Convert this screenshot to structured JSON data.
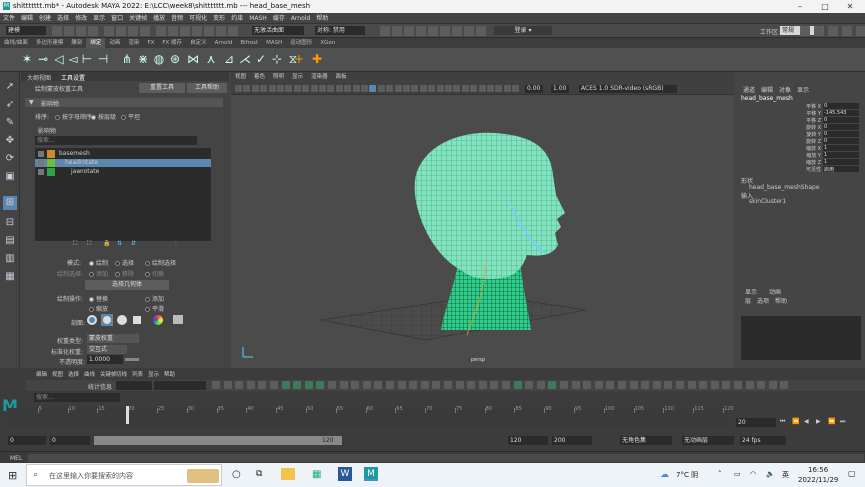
{
  "window": {
    "title": "shittttttt.mb* - Autodesk MAYA 2022: E:\\LCC\\week8\\shittttttt.mb  ---  head_base_mesh"
  },
  "menubar": [
    "文件",
    "编辑",
    "创建",
    "选择",
    "修改",
    "显示",
    "窗口",
    "关键帧",
    "播放",
    "音频",
    "可视化",
    "变形",
    "约束",
    "MASH",
    "缓存",
    "Arnold",
    "帮助"
  ],
  "workspace": {
    "label": "工作区:",
    "value": "常规"
  },
  "statusline": {
    "mode": "建模",
    "snap_label": "无激活曲面",
    "symmetry": "对称: 禁用",
    "login": "登录"
  },
  "shelf_tabs": [
    "曲线/曲面",
    "多边形建模",
    "雕刻",
    "绑定",
    "动画",
    "渲染",
    "FX",
    "FX 缓存",
    "自定义",
    "Arnold",
    "Bifrost",
    "MASH",
    "运动图形",
    "XGen"
  ],
  "shelf_active": "绑定",
  "tool_tabs": [
    "大纲视图",
    "工具设置"
  ],
  "tool_title": "绘制蒙皮权重工具",
  "tool_buttons": {
    "reset": "重置工具",
    "help": "工具帮助"
  },
  "influence_header": "影响物",
  "sort": {
    "label": "排序:",
    "options": [
      "按字母顺序",
      "按层级",
      "平坦"
    ]
  },
  "search_placeholder": "搜索...",
  "joints": [
    {
      "name": "basemesh",
      "color": "#d08a2a"
    },
    {
      "name": "headrotate",
      "color": "#6bbf3a"
    },
    {
      "name": "jawrotate",
      "color": "#2fa34a"
    }
  ],
  "mode": {
    "label": "模式:",
    "options": [
      "绘制",
      "选择",
      "绘制选择"
    ]
  },
  "paint_select": {
    "label": "绘制选择:",
    "options": [
      "添加",
      "移除",
      "切换"
    ]
  },
  "select_geo": "选择几何体",
  "paint_op": {
    "label": "绘制操作:",
    "options": [
      "替换",
      "添加",
      "缩放",
      "平滑"
    ]
  },
  "profile_label": "剖面:",
  "weight_type": {
    "label": "权重类型:",
    "value": "蒙皮权重"
  },
  "normalize": {
    "label": "标准化权重:",
    "value": "交互式"
  },
  "opacity": {
    "label": "不透明度:",
    "value": "1.0000"
  },
  "viewport_menu": [
    "视图",
    "着色",
    "照明",
    "显示",
    "渲染器",
    "面板"
  ],
  "viewport_fields": {
    "v1": "0.00",
    "v2": "1.00",
    "colorspace": "ACES 1.0 SDR-video (sRGB)"
  },
  "viewport_label": "persp",
  "channel_tabs": [
    "通道",
    "编辑",
    "对象",
    "显示"
  ],
  "object_name": "head_base_mesh",
  "attributes": [
    {
      "name": "平移 X",
      "value": "0"
    },
    {
      "name": "平移 Y",
      "value": "-145.543"
    },
    {
      "name": "平移 Z",
      "value": "0"
    },
    {
      "name": "旋转 X",
      "value": "0"
    },
    {
      "name": "旋转 Y",
      "value": "0"
    },
    {
      "name": "旋转 Z",
      "value": "0"
    },
    {
      "name": "缩放 X",
      "value": "1"
    },
    {
      "name": "缩放 Y",
      "value": "1"
    },
    {
      "name": "缩放 Z",
      "value": "1"
    },
    {
      "name": "可见性",
      "value": "启用"
    }
  ],
  "shapes_label": "形状",
  "shape_name": "head_base_meshShape",
  "inputs_label": "输入",
  "input_name": "skinCluster1",
  "layer_tabs": [
    "显示",
    "动画"
  ],
  "layer_menu": [
    "层",
    "选项",
    "帮助"
  ],
  "timeline": {
    "ticks": [
      "5",
      "10",
      "15",
      "20",
      "25",
      "30",
      "35",
      "40",
      "45",
      "50",
      "55",
      "60",
      "65",
      "70",
      "75",
      "80",
      "85",
      "90",
      "95",
      "100",
      "105",
      "110",
      "115",
      "120"
    ],
    "current": "20",
    "start": "0",
    "start2": "0",
    "range_end": "120",
    "end": "120",
    "end2": "200"
  },
  "graph_menu": [
    "编辑",
    "视图",
    "选择",
    "曲线",
    "关键帧",
    "切线",
    "列表",
    "显示",
    "帮助"
  ],
  "graph_search": "搜索...",
  "stats_label": "统计信息",
  "playback": {
    "char": "无角色集",
    "layer": "无动画层",
    "fps": "24 fps"
  },
  "mel_label": "MEL",
  "taskbar": {
    "search": "在这里输入你要搜索的内容",
    "temp": "7°C 阴",
    "ime": "英",
    "time": "16:56",
    "date": "2022/11/29"
  }
}
